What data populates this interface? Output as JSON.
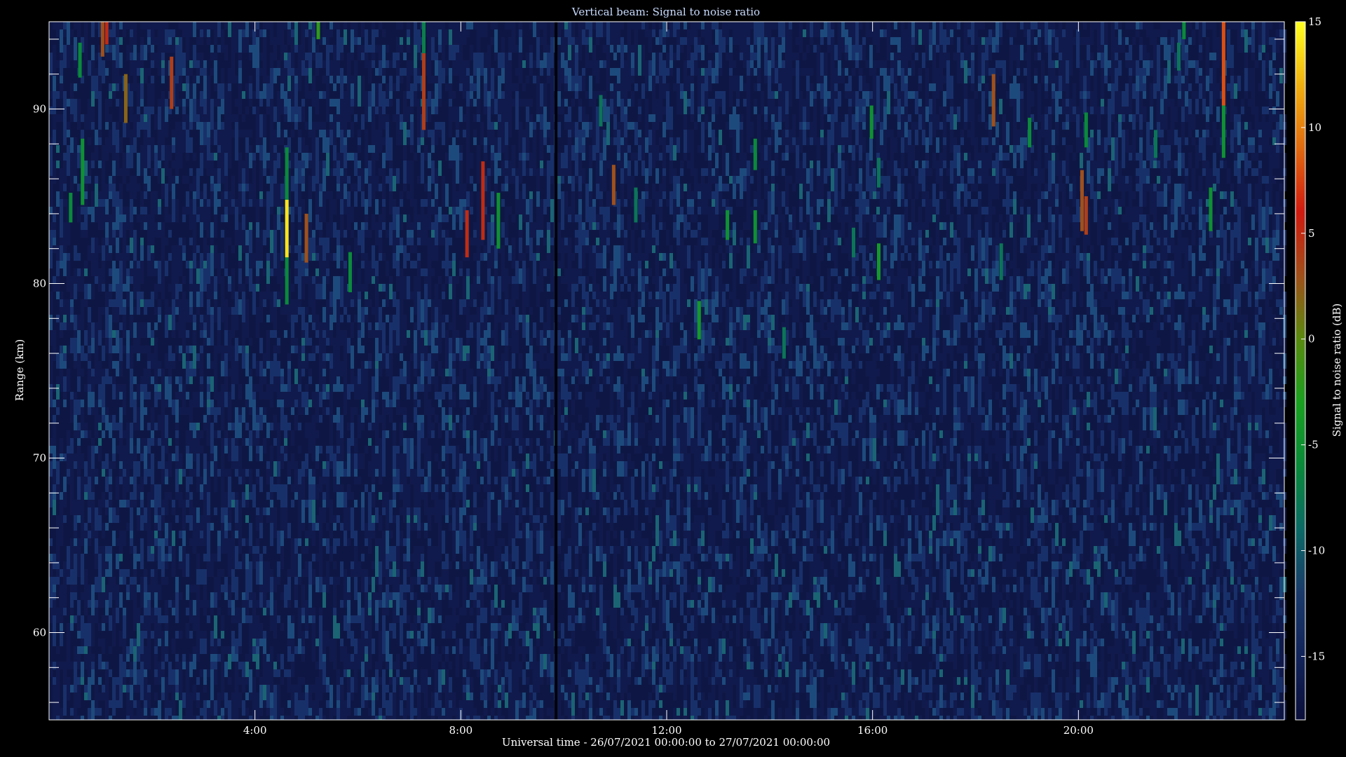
{
  "chart_data": {
    "type": "heatmap",
    "title": "Vertical beam: Signal to noise ratio",
    "xlabel": "Universal time - 26/07/2021 00:00:00 to 27/07/2021 00:00:00",
    "ylabel": "Range (km)",
    "colorbar_label": "Signal to noise ratio (dB)",
    "x_range_hours": [
      0,
      24
    ],
    "x_ticks": [
      {
        "hour": 4,
        "label": "4:00"
      },
      {
        "hour": 8,
        "label": "8:00"
      },
      {
        "hour": 12,
        "label": "12:00"
      },
      {
        "hour": 16,
        "label": "16:00"
      },
      {
        "hour": 20,
        "label": "20:00"
      }
    ],
    "y_range_km": [
      55,
      95
    ],
    "y_ticks": [
      {
        "km": 60,
        "label": "60"
      },
      {
        "km": 70,
        "label": "70"
      },
      {
        "km": 80,
        "label": "80"
      },
      {
        "km": 90,
        "label": "90"
      }
    ],
    "colorbar_range_db": [
      -18,
      15
    ],
    "colorbar_ticks": [
      {
        "db": 15,
        "label": "15"
      },
      {
        "db": 10,
        "label": "10"
      },
      {
        "db": 5,
        "label": "5"
      },
      {
        "db": 0,
        "label": "0"
      },
      {
        "db": -5,
        "label": "-5"
      },
      {
        "db": -10,
        "label": "-10"
      },
      {
        "db": -15,
        "label": "-15"
      }
    ],
    "colorscale": [
      "#0b0f3a",
      "#12245a",
      "#1a3a6a",
      "#0c6a66",
      "#0a8a3a",
      "#1aa020",
      "#5a8a10",
      "#a0501a",
      "#d01a10",
      "#e06a10",
      "#f0b010",
      "#ffff20"
    ],
    "background_snr_db": -15,
    "data_gap_hour": 9.85,
    "echoes": [
      {
        "hour": 0.42,
        "km_low": 83.5,
        "km_high": 85.2,
        "snr_db": -6
      },
      {
        "hour": 0.65,
        "km_low": 84.5,
        "km_high": 88.3,
        "snr_db": -5
      },
      {
        "hour": 0.6,
        "km_low": 91.8,
        "km_high": 93.8,
        "snr_db": -6
      },
      {
        "hour": 1.04,
        "km_low": 93.0,
        "km_high": 95.0,
        "snr_db": 3
      },
      {
        "hour": 1.12,
        "km_low": 93.7,
        "km_high": 95.0,
        "snr_db": 5
      },
      {
        "hour": 1.49,
        "km_low": 89.2,
        "km_high": 92.0,
        "snr_db": 2
      },
      {
        "hour": 2.38,
        "km_low": 90.0,
        "km_high": 93.0,
        "snr_db": 4
      },
      {
        "hour": 4.62,
        "km_low": 78.8,
        "km_high": 81.5,
        "snr_db": -6
      },
      {
        "hour": 4.62,
        "km_low": 81.5,
        "km_high": 84.8,
        "snr_db": 14
      },
      {
        "hour": 4.62,
        "km_low": 84.8,
        "km_high": 87.8,
        "snr_db": -6
      },
      {
        "hour": 5.0,
        "km_low": 81.2,
        "km_high": 84.0,
        "snr_db": 3
      },
      {
        "hour": 5.23,
        "km_low": 94.0,
        "km_high": 95.0,
        "snr_db": -2
      },
      {
        "hour": 5.85,
        "km_low": 79.5,
        "km_high": 81.8,
        "snr_db": -6
      },
      {
        "hour": 7.28,
        "km_low": 88.8,
        "km_high": 93.2,
        "snr_db": 4
      },
      {
        "hour": 7.28,
        "km_low": 93.2,
        "km_high": 95.0,
        "snr_db": -7
      },
      {
        "hour": 8.12,
        "km_low": 81.5,
        "km_high": 84.2,
        "snr_db": 5
      },
      {
        "hour": 8.43,
        "km_low": 82.5,
        "km_high": 87.0,
        "snr_db": 5
      },
      {
        "hour": 8.73,
        "km_low": 82.0,
        "km_high": 85.2,
        "snr_db": -5
      },
      {
        "hour": 10.72,
        "km_low": 89.0,
        "km_high": 90.8,
        "snr_db": -8
      },
      {
        "hour": 10.97,
        "km_low": 84.5,
        "km_high": 86.8,
        "snr_db": 3
      },
      {
        "hour": 11.4,
        "km_low": 83.5,
        "km_high": 85.5,
        "snr_db": -8
      },
      {
        "hour": 12.63,
        "km_low": 76.8,
        "km_high": 79.0,
        "snr_db": -4
      },
      {
        "hour": 13.18,
        "km_low": 82.5,
        "km_high": 84.2,
        "snr_db": -5
      },
      {
        "hour": 13.72,
        "km_low": 82.3,
        "km_high": 84.2,
        "snr_db": -5
      },
      {
        "hour": 13.72,
        "km_low": 86.5,
        "km_high": 88.3,
        "snr_db": -6
      },
      {
        "hour": 14.28,
        "km_low": 75.7,
        "km_high": 77.5,
        "snr_db": -8
      },
      {
        "hour": 15.63,
        "km_low": 81.5,
        "km_high": 83.2,
        "snr_db": -8
      },
      {
        "hour": 15.98,
        "km_low": 88.3,
        "km_high": 90.2,
        "snr_db": -5
      },
      {
        "hour": 16.12,
        "km_low": 80.2,
        "km_high": 82.3,
        "snr_db": -4
      },
      {
        "hour": 16.12,
        "km_low": 85.5,
        "km_high": 87.2,
        "snr_db": -8
      },
      {
        "hour": 18.35,
        "km_low": 89.0,
        "km_high": 92.0,
        "snr_db": 3
      },
      {
        "hour": 18.5,
        "km_low": 80.2,
        "km_high": 82.3,
        "snr_db": -8
      },
      {
        "hour": 19.05,
        "km_low": 87.8,
        "km_high": 89.5,
        "snr_db": -6
      },
      {
        "hour": 20.07,
        "km_low": 83.0,
        "km_high": 86.5,
        "snr_db": 3
      },
      {
        "hour": 20.15,
        "km_low": 82.8,
        "km_high": 85.0,
        "snr_db": 4
      },
      {
        "hour": 20.15,
        "km_low": 87.8,
        "km_high": 89.8,
        "snr_db": -6
      },
      {
        "hour": 21.5,
        "km_low": 87.2,
        "km_high": 88.8,
        "snr_db": -8
      },
      {
        "hour": 21.95,
        "km_low": 92.2,
        "km_high": 93.8,
        "snr_db": -8
      },
      {
        "hour": 22.05,
        "km_low": 94.0,
        "km_high": 95.0,
        "snr_db": -6
      },
      {
        "hour": 22.57,
        "km_low": 83.0,
        "km_high": 85.5,
        "snr_db": -5
      },
      {
        "hour": 22.82,
        "km_low": 90.2,
        "km_high": 95.0,
        "snr_db": 8
      },
      {
        "hour": 22.82,
        "km_low": 87.2,
        "km_high": 90.2,
        "snr_db": -5
      }
    ]
  }
}
